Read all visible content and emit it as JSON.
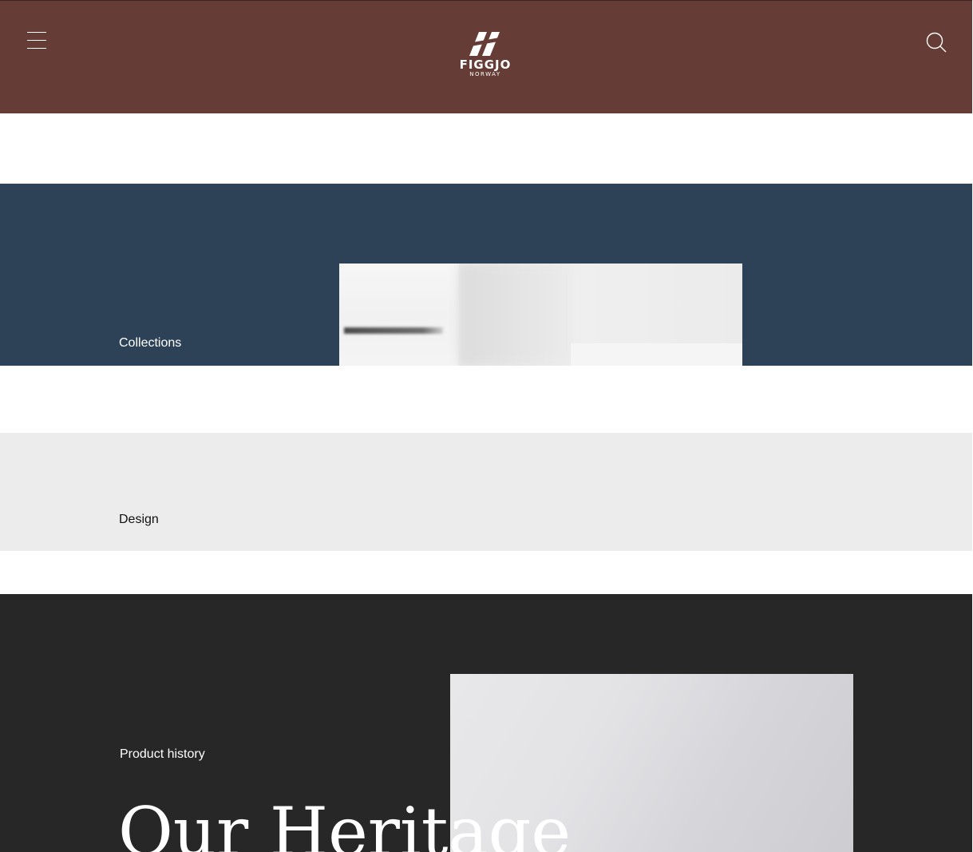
{
  "header": {
    "menu_icon": "hamburger-menu-icon",
    "logo": {
      "word": "FIGGJO",
      "sub": "NORWAY"
    },
    "search_icon": "search-icon"
  },
  "sections": {
    "collections": {
      "label": "Collections"
    },
    "design": {
      "label": "Design"
    },
    "heritage": {
      "label": "Product history",
      "title": "Our Heritage"
    }
  },
  "colors": {
    "header_bg": "#663c36",
    "collections_bg": "#2e4257",
    "design_bg": "#ececec",
    "heritage_bg": "#272727"
  }
}
